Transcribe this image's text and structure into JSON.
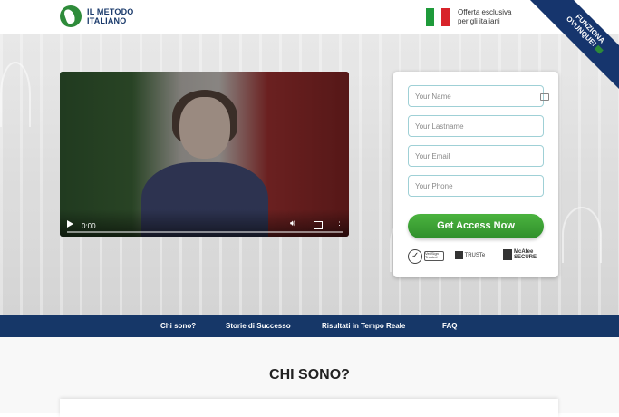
{
  "header": {
    "logo_line1": "IL METODO",
    "logo_line2": "ITALIANO",
    "offer_line1": "Offerta esclusiva",
    "offer_line2": "per gli italiani",
    "corner_line1": "FUNZIONA",
    "corner_line2": "OVUNQUE!",
    "flag_colors": [
      "#1e9a3a",
      "#ffffff",
      "#d8232a"
    ]
  },
  "video": {
    "time": "0:00",
    "volume_icon": "volume-icon",
    "fullscreen_icon": "fullscreen-icon",
    "more_icon": "more-options-icon"
  },
  "form": {
    "name_placeholder": "Your Name",
    "lastname_placeholder": "Your Lastname",
    "email_placeholder": "Your Email",
    "phone_placeholder": "Your Phone",
    "cta_label": "Get Access Now",
    "seal_verified": "VeriSign Trusted",
    "seal_truste": "TRUSTe",
    "seal_mcafee_line1": "McAfee",
    "seal_mcafee_line2": "SECURE"
  },
  "nav": {
    "items": [
      "Chi sono?",
      "Storie di Successo",
      "Risultati in Tempo Reale",
      "FAQ"
    ]
  },
  "section": {
    "title": "CHI SONO?"
  },
  "colors": {
    "nav_bg": "#163768",
    "cta_green": "#3ea336",
    "field_border": "#9fd0d6"
  }
}
